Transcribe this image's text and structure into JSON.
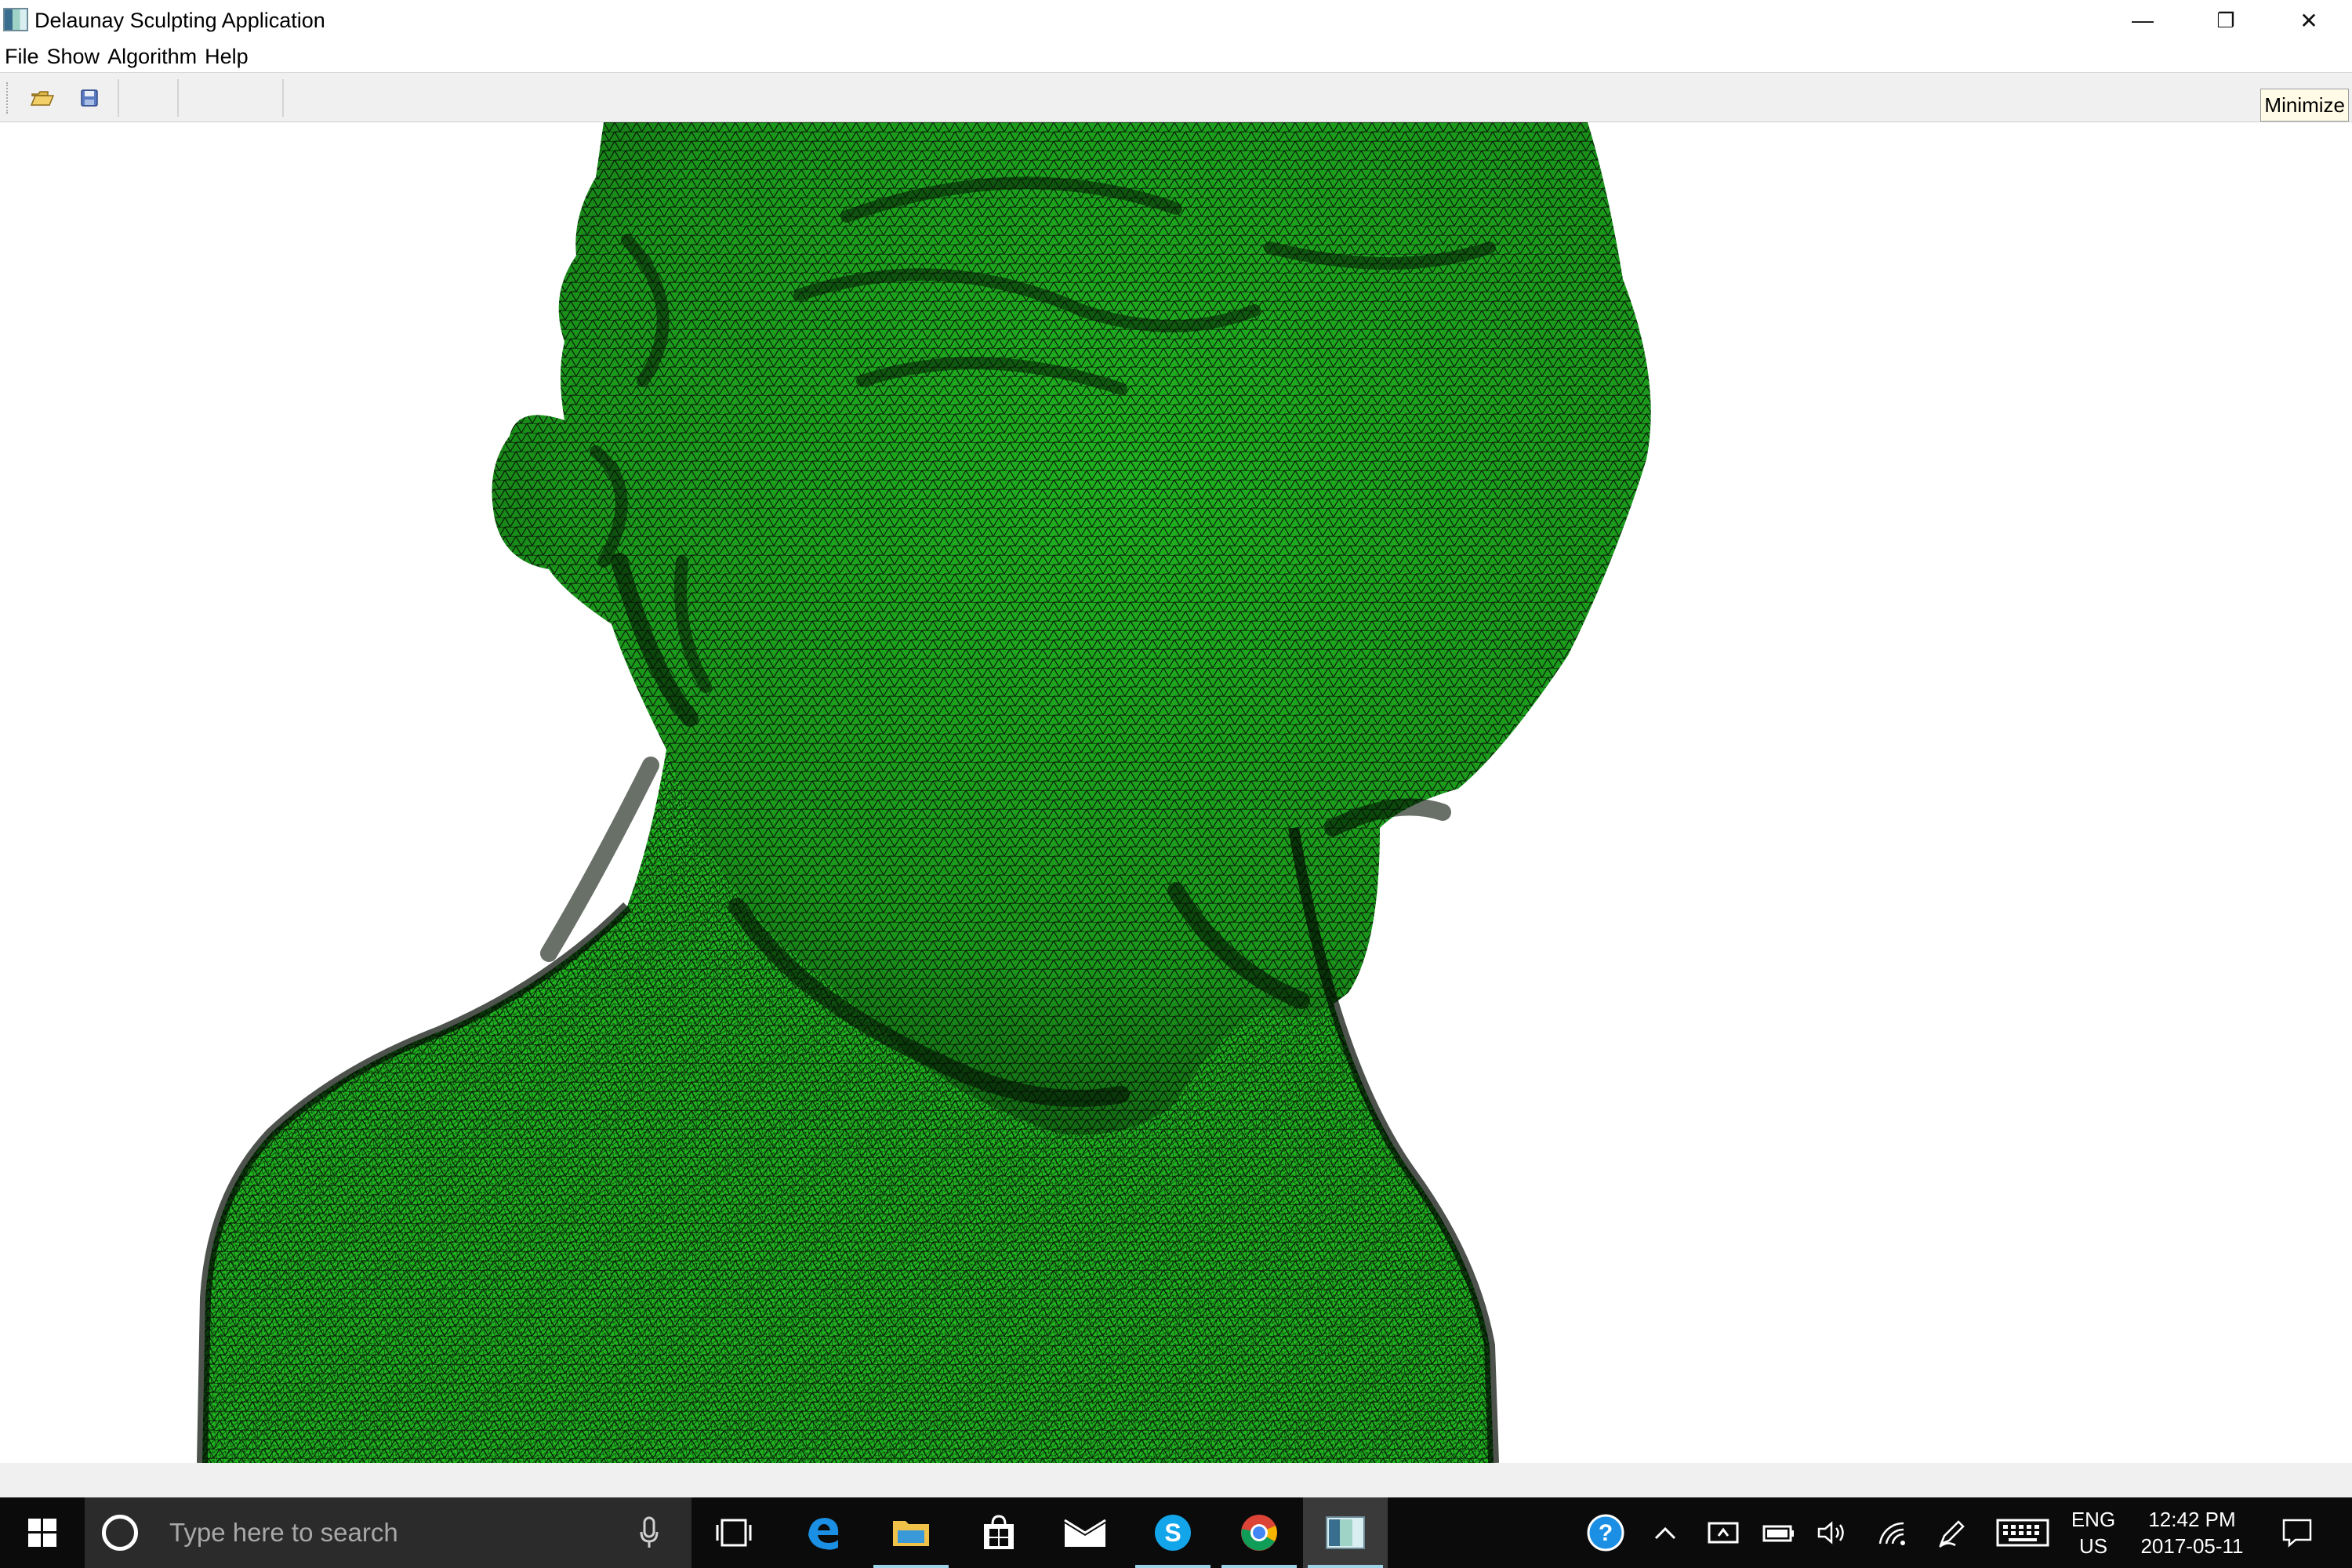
{
  "window": {
    "title": "Delaunay Sculpting Application",
    "controls": {
      "minimize": "—",
      "restore": "❐",
      "close": "✕"
    }
  },
  "menu": [
    "File",
    "Show",
    "Algorithm",
    "Help"
  ],
  "toolbar": {
    "open_icon": "folder-open-icon",
    "save_icon": "save-disk-icon",
    "minimize_label": "Minimize"
  },
  "viewport": {
    "content": "green triangulated mesh of a sculpted head and shoulders",
    "mesh_color": "#1fb21f",
    "edge_color": "#0a0a0a",
    "background": "#ffffff"
  },
  "taskbar": {
    "search_placeholder": "Type here to search",
    "apps": [
      "task-view-icon",
      "edge-icon",
      "file-explorer-icon",
      "store-icon",
      "mail-icon",
      "skype-icon",
      "chrome-icon",
      "delaunay-app-icon"
    ],
    "tray": {
      "language_top": "ENG",
      "language_bottom": "US",
      "time": "12:42 PM",
      "date": "2017-05-11"
    }
  },
  "colors": {
    "taskbar_bg": "#0b0b0b",
    "search_bg": "#2b2b2b",
    "accent": "#0078d7"
  }
}
